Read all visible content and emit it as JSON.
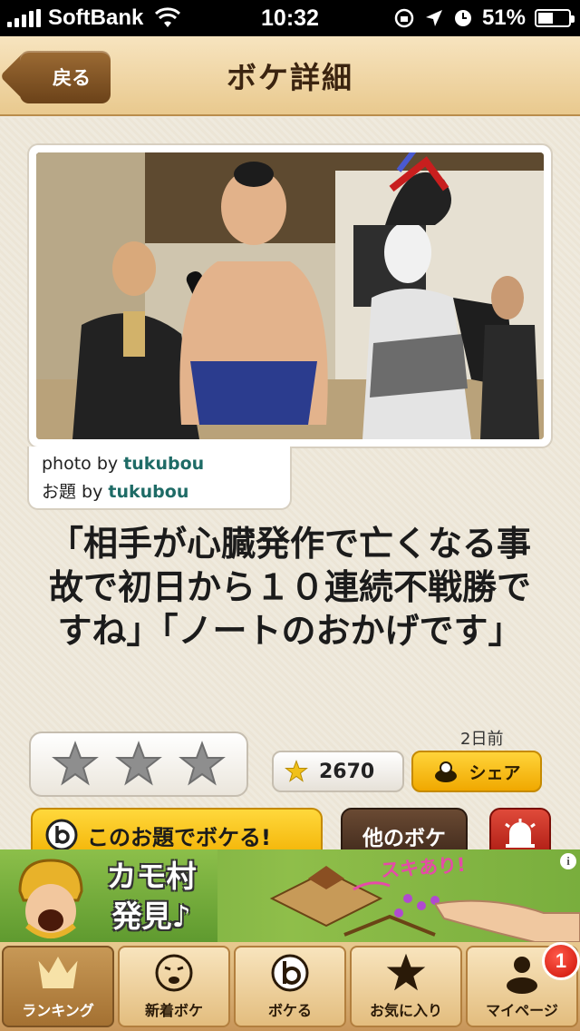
{
  "status_bar": {
    "carrier": "SoftBank",
    "time": "10:32",
    "battery": "51%"
  },
  "nav": {
    "back_label": "戻る",
    "title": "ボケ詳細"
  },
  "post": {
    "photo_label": "photo by",
    "photo_user": "tukubou",
    "odai_label": "お題 by",
    "odai_user": "tukubou",
    "boke_text": "「相手が心臓発作で亡くなる事故で初日から１０連続不戦勝ですね」「ノートのおかげです」",
    "time_ago": "2日前",
    "star_count": "2670",
    "share_label": "シェア"
  },
  "actions": {
    "boke_this_label": "このお題でボケる!",
    "other_boke_label": "他のボケ"
  },
  "ad": {
    "title_line1": "カモ村",
    "title_line2": "発見♪",
    "caption": "スキあり!",
    "info": "i"
  },
  "tabs": [
    {
      "label": "ランキング",
      "icon": "crown-icon",
      "active": true
    },
    {
      "label": "新着ボケ",
      "icon": "face-icon",
      "active": false
    },
    {
      "label": "ボケる",
      "icon": "b-logo-icon",
      "active": false
    },
    {
      "label": "お気に入り",
      "icon": "star-icon",
      "active": false
    },
    {
      "label": "マイページ",
      "icon": "person-icon",
      "active": false,
      "badge": "1"
    }
  ],
  "colors": {
    "nav_bg": "#e9c98e",
    "accent_yellow": "#f2b000",
    "link_teal": "#1e6b66",
    "badge_red": "#cc1005"
  }
}
